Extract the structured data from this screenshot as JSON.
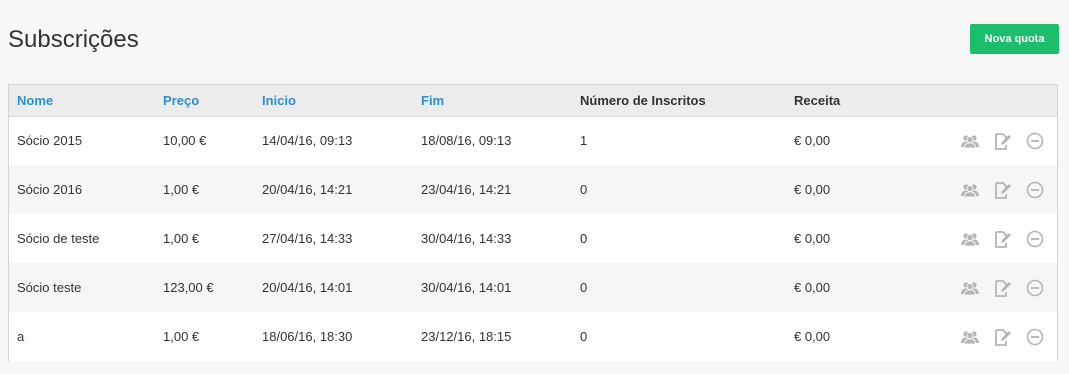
{
  "page": {
    "title": "Subscrições",
    "new_button_label": "Nova quota"
  },
  "table": {
    "columns": [
      {
        "label": "Nome",
        "sortable": true
      },
      {
        "label": "Preço",
        "sortable": true
      },
      {
        "label": "Inicio",
        "sortable": true
      },
      {
        "label": "Fim",
        "sortable": true
      },
      {
        "label": "Número de Inscritos",
        "sortable": false
      },
      {
        "label": "Receita",
        "sortable": false
      }
    ],
    "rows": [
      {
        "nome": "Sócio 2015",
        "preco": "10,00 €",
        "inicio": "14/04/16, 09:13",
        "fim": "18/08/16, 09:13",
        "inscritos": "1",
        "receita": "€ 0,00"
      },
      {
        "nome": "Sócio 2016",
        "preco": "1,00 €",
        "inicio": "20/04/16, 14:21",
        "fim": "23/04/16, 14:21",
        "inscritos": "0",
        "receita": "€ 0,00"
      },
      {
        "nome": "Sócio de teste",
        "preco": "1,00 €",
        "inicio": "27/04/16, 14:33",
        "fim": "30/04/16, 14:33",
        "inscritos": "0",
        "receita": "€ 0,00"
      },
      {
        "nome": "Sócio teste",
        "preco": "123,00 €",
        "inicio": "20/04/16, 14:01",
        "fim": "30/04/16, 14:01",
        "inscritos": "0",
        "receita": "€ 0,00"
      },
      {
        "nome": "a",
        "preco": "1,00 €",
        "inicio": "18/06/16, 18:30",
        "fim": "23/12/16, 18:15",
        "inscritos": "0",
        "receita": "€ 0,00"
      }
    ],
    "row_actions": [
      "members-icon",
      "edit-icon",
      "remove-icon"
    ]
  },
  "colors": {
    "accent_green": "#1cbe6c",
    "link_blue": "#2b8fd0",
    "icon_gray": "#b5b5b5"
  }
}
